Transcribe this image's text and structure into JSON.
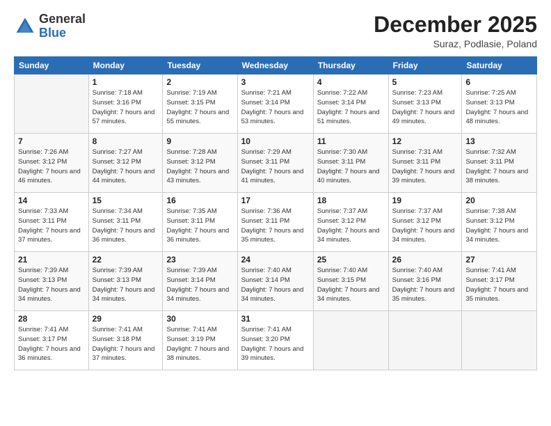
{
  "header": {
    "logo_general": "General",
    "logo_blue": "Blue",
    "month_title": "December 2025",
    "location": "Suraz, Podlasie, Poland"
  },
  "days_of_week": [
    "Sunday",
    "Monday",
    "Tuesday",
    "Wednesday",
    "Thursday",
    "Friday",
    "Saturday"
  ],
  "weeks": [
    [
      {
        "day": "",
        "sunrise": "",
        "sunset": "",
        "daylight": ""
      },
      {
        "day": "1",
        "sunrise": "Sunrise: 7:18 AM",
        "sunset": "Sunset: 3:16 PM",
        "daylight": "Daylight: 7 hours and 57 minutes."
      },
      {
        "day": "2",
        "sunrise": "Sunrise: 7:19 AM",
        "sunset": "Sunset: 3:15 PM",
        "daylight": "Daylight: 7 hours and 55 minutes."
      },
      {
        "day": "3",
        "sunrise": "Sunrise: 7:21 AM",
        "sunset": "Sunset: 3:14 PM",
        "daylight": "Daylight: 7 hours and 53 minutes."
      },
      {
        "day": "4",
        "sunrise": "Sunrise: 7:22 AM",
        "sunset": "Sunset: 3:14 PM",
        "daylight": "Daylight: 7 hours and 51 minutes."
      },
      {
        "day": "5",
        "sunrise": "Sunrise: 7:23 AM",
        "sunset": "Sunset: 3:13 PM",
        "daylight": "Daylight: 7 hours and 49 minutes."
      },
      {
        "day": "6",
        "sunrise": "Sunrise: 7:25 AM",
        "sunset": "Sunset: 3:13 PM",
        "daylight": "Daylight: 7 hours and 48 minutes."
      }
    ],
    [
      {
        "day": "7",
        "sunrise": "Sunrise: 7:26 AM",
        "sunset": "Sunset: 3:12 PM",
        "daylight": "Daylight: 7 hours and 46 minutes."
      },
      {
        "day": "8",
        "sunrise": "Sunrise: 7:27 AM",
        "sunset": "Sunset: 3:12 PM",
        "daylight": "Daylight: 7 hours and 44 minutes."
      },
      {
        "day": "9",
        "sunrise": "Sunrise: 7:28 AM",
        "sunset": "Sunset: 3:12 PM",
        "daylight": "Daylight: 7 hours and 43 minutes."
      },
      {
        "day": "10",
        "sunrise": "Sunrise: 7:29 AM",
        "sunset": "Sunset: 3:11 PM",
        "daylight": "Daylight: 7 hours and 41 minutes."
      },
      {
        "day": "11",
        "sunrise": "Sunrise: 7:30 AM",
        "sunset": "Sunset: 3:11 PM",
        "daylight": "Daylight: 7 hours and 40 minutes."
      },
      {
        "day": "12",
        "sunrise": "Sunrise: 7:31 AM",
        "sunset": "Sunset: 3:11 PM",
        "daylight": "Daylight: 7 hours and 39 minutes."
      },
      {
        "day": "13",
        "sunrise": "Sunrise: 7:32 AM",
        "sunset": "Sunset: 3:11 PM",
        "daylight": "Daylight: 7 hours and 38 minutes."
      }
    ],
    [
      {
        "day": "14",
        "sunrise": "Sunrise: 7:33 AM",
        "sunset": "Sunset: 3:11 PM",
        "daylight": "Daylight: 7 hours and 37 minutes."
      },
      {
        "day": "15",
        "sunrise": "Sunrise: 7:34 AM",
        "sunset": "Sunset: 3:11 PM",
        "daylight": "Daylight: 7 hours and 36 minutes."
      },
      {
        "day": "16",
        "sunrise": "Sunrise: 7:35 AM",
        "sunset": "Sunset: 3:11 PM",
        "daylight": "Daylight: 7 hours and 36 minutes."
      },
      {
        "day": "17",
        "sunrise": "Sunrise: 7:36 AM",
        "sunset": "Sunset: 3:11 PM",
        "daylight": "Daylight: 7 hours and 35 minutes."
      },
      {
        "day": "18",
        "sunrise": "Sunrise: 7:37 AM",
        "sunset": "Sunset: 3:12 PM",
        "daylight": "Daylight: 7 hours and 34 minutes."
      },
      {
        "day": "19",
        "sunrise": "Sunrise: 7:37 AM",
        "sunset": "Sunset: 3:12 PM",
        "daylight": "Daylight: 7 hours and 34 minutes."
      },
      {
        "day": "20",
        "sunrise": "Sunrise: 7:38 AM",
        "sunset": "Sunset: 3:12 PM",
        "daylight": "Daylight: 7 hours and 34 minutes."
      }
    ],
    [
      {
        "day": "21",
        "sunrise": "Sunrise: 7:39 AM",
        "sunset": "Sunset: 3:13 PM",
        "daylight": "Daylight: 7 hours and 34 minutes."
      },
      {
        "day": "22",
        "sunrise": "Sunrise: 7:39 AM",
        "sunset": "Sunset: 3:13 PM",
        "daylight": "Daylight: 7 hours and 34 minutes."
      },
      {
        "day": "23",
        "sunrise": "Sunrise: 7:39 AM",
        "sunset": "Sunset: 3:14 PM",
        "daylight": "Daylight: 7 hours and 34 minutes."
      },
      {
        "day": "24",
        "sunrise": "Sunrise: 7:40 AM",
        "sunset": "Sunset: 3:14 PM",
        "daylight": "Daylight: 7 hours and 34 minutes."
      },
      {
        "day": "25",
        "sunrise": "Sunrise: 7:40 AM",
        "sunset": "Sunset: 3:15 PM",
        "daylight": "Daylight: 7 hours and 34 minutes."
      },
      {
        "day": "26",
        "sunrise": "Sunrise: 7:40 AM",
        "sunset": "Sunset: 3:16 PM",
        "daylight": "Daylight: 7 hours and 35 minutes."
      },
      {
        "day": "27",
        "sunrise": "Sunrise: 7:41 AM",
        "sunset": "Sunset: 3:17 PM",
        "daylight": "Daylight: 7 hours and 35 minutes."
      }
    ],
    [
      {
        "day": "28",
        "sunrise": "Sunrise: 7:41 AM",
        "sunset": "Sunset: 3:17 PM",
        "daylight": "Daylight: 7 hours and 36 minutes."
      },
      {
        "day": "29",
        "sunrise": "Sunrise: 7:41 AM",
        "sunset": "Sunset: 3:18 PM",
        "daylight": "Daylight: 7 hours and 37 minutes."
      },
      {
        "day": "30",
        "sunrise": "Sunrise: 7:41 AM",
        "sunset": "Sunset: 3:19 PM",
        "daylight": "Daylight: 7 hours and 38 minutes."
      },
      {
        "day": "31",
        "sunrise": "Sunrise: 7:41 AM",
        "sunset": "Sunset: 3:20 PM",
        "daylight": "Daylight: 7 hours and 39 minutes."
      },
      {
        "day": "",
        "sunrise": "",
        "sunset": "",
        "daylight": ""
      },
      {
        "day": "",
        "sunrise": "",
        "sunset": "",
        "daylight": ""
      },
      {
        "day": "",
        "sunrise": "",
        "sunset": "",
        "daylight": ""
      }
    ]
  ]
}
